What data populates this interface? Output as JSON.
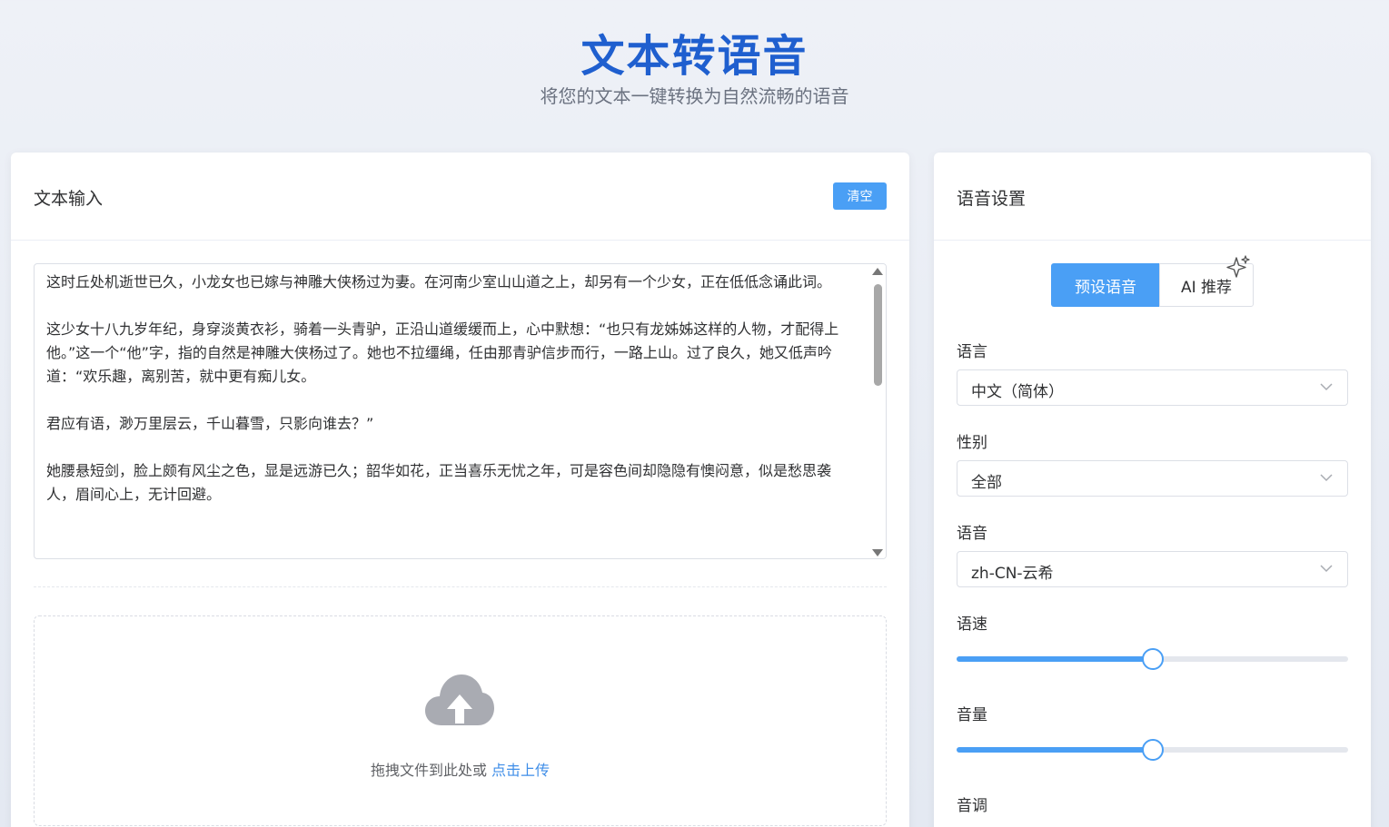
{
  "header": {
    "title": "文本转语音",
    "subtitle": "将您的文本一键转换为自然流畅的语音"
  },
  "text_input": {
    "title": "文本输入",
    "clear_label": "清空",
    "content": "这时丘处机逝世已久，小龙女也已嫁与神雕大侠杨过为妻。在河南少室山山道之上，却另有一个少女，正在低低念诵此词。\n\n这少女十八九岁年纪，身穿淡黄衣衫，骑着一头青驴，正沿山道缓缓而上，心中默想：“也只有龙姊姊这样的人物，才配得上他。”这一个“他”字，指的自然是神雕大侠杨过了。她也不拉缰绳，任由那青驴信步而行，一路上山。过了良久，她又低声吟道：“欢乐趣，离别苦，就中更有痴儿女。\n\n君应有语，渺万里层云，千山暮雪，只影向谁去？”\n\n她腰悬短剑，脸上颇有风尘之色，显是远游已久；韶华如花，正当喜乐无忧之年，可是容色间却隐隐有懊闷意，似是愁思袭人，眉间心上，无计回避。",
    "upload_text": "拖拽文件到此处或",
    "upload_link": "点击上传"
  },
  "voice_settings": {
    "title": "语音设置",
    "tabs": {
      "preset": "预设语音",
      "ai": "AI 推荐"
    },
    "language": {
      "label": "语言",
      "value": "中文（简体）"
    },
    "gender": {
      "label": "性别",
      "value": "全部"
    },
    "voice": {
      "label": "语音",
      "value": "zh-CN-云希"
    },
    "rate": {
      "label": "语速",
      "level": 0.5
    },
    "volume": {
      "label": "音量",
      "level": 0.5
    },
    "pitch": {
      "label": "音调"
    }
  },
  "colors": {
    "accent": "#4a9ff5",
    "title": "#1f5fcf",
    "link": "#3f8ee8"
  }
}
